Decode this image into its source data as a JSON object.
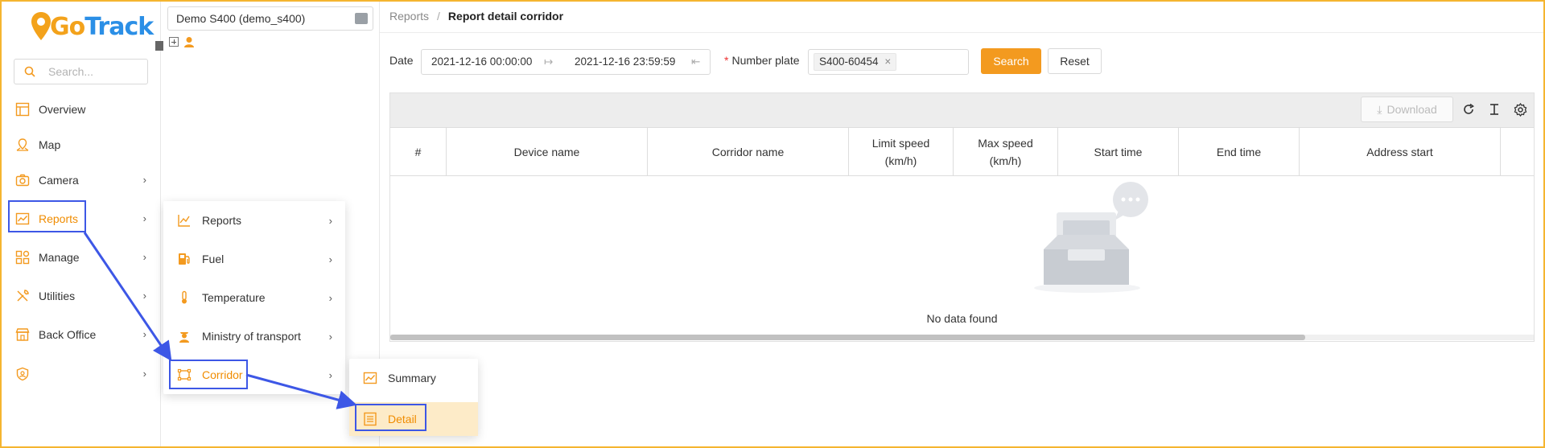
{
  "app": {
    "logo_go": "Go",
    "logo_track": "Track"
  },
  "search": {
    "placeholder": "Search..."
  },
  "sidebar": {
    "items": [
      {
        "label": "Overview"
      },
      {
        "label": "Map"
      },
      {
        "label": "Camera"
      },
      {
        "label": "Reports"
      },
      {
        "label": "Manage"
      },
      {
        "label": "Utilities"
      },
      {
        "label": "Back Office"
      },
      {
        "label": ""
      }
    ]
  },
  "tree": {
    "selected_account": "Demo S400 (demo_s400)"
  },
  "reports_menu": {
    "items": [
      {
        "label": "Reports"
      },
      {
        "label": "Fuel"
      },
      {
        "label": "Temperature"
      },
      {
        "label": "Ministry of transport"
      },
      {
        "label": "Corridor"
      }
    ]
  },
  "corridor_menu": {
    "items": [
      {
        "label": "Summary"
      },
      {
        "label": "Detail"
      }
    ]
  },
  "breadcrumb": {
    "parent": "Reports",
    "separator": "/",
    "current": "Report detail corridor"
  },
  "filters": {
    "date_label": "Date",
    "date_start": "2021-12-16 00:00:00",
    "date_end": "2021-12-16 23:59:59",
    "plate_required_mark": "*",
    "plate_label": "Number plate",
    "plate_tag": "S400-60454",
    "plate_tag_close": "×",
    "search_label": "Search",
    "reset_label": "Reset"
  },
  "toolbar": {
    "download_label": "Download"
  },
  "table": {
    "headers": [
      {
        "label": "#"
      },
      {
        "label": "Device name"
      },
      {
        "label": "Corridor name"
      },
      {
        "label": "Limit speed (km/h)"
      },
      {
        "label": "Max speed (km/h)"
      },
      {
        "label": "Start time"
      },
      {
        "label": "End time"
      },
      {
        "label": "Address start"
      },
      {
        "label": ""
      }
    ],
    "empty_text": "No data found"
  },
  "colors": {
    "accent": "#f39a1f",
    "brand_blue": "#2b8fe6",
    "highlight": "#3d57e6",
    "frame": "#f5b530"
  },
  "scroll": {
    "horizontal_fraction_visible": 0.8
  }
}
